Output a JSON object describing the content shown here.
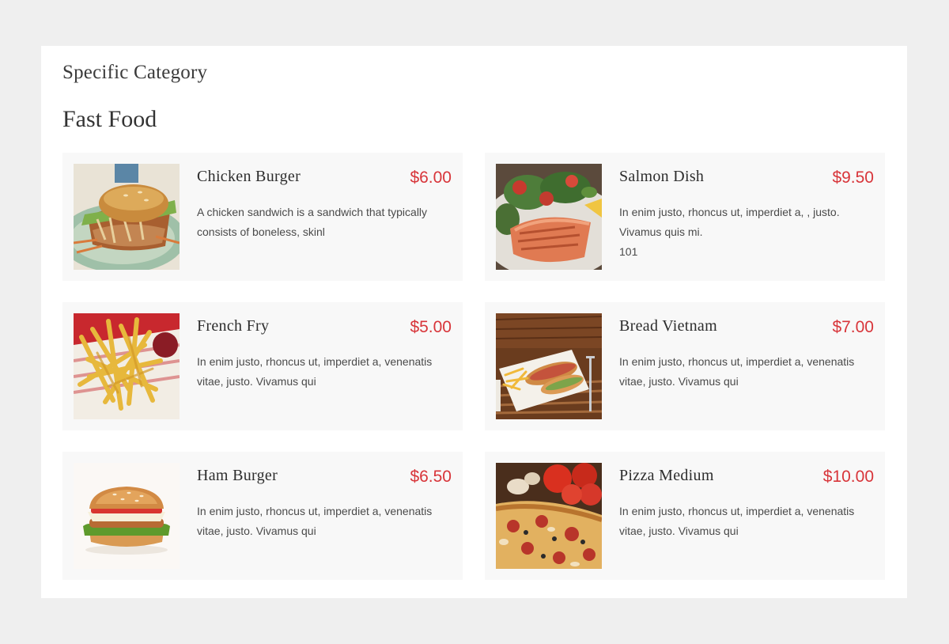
{
  "page": {
    "category_label": "Specific Category",
    "section_title": "Fast Food"
  },
  "theme": {
    "price_color": "#d8353a",
    "card_background": "#f8f8f8",
    "page_background": "#efefef"
  },
  "menu": {
    "items": [
      {
        "name": "Chicken Burger",
        "price": "$6.00",
        "description": "A chicken sandwich is a sandwich that typically consists of boneless, skinl",
        "image": "chicken-burger-photo"
      },
      {
        "name": "Salmon Dish",
        "price": "$9.50",
        "description": "In enim justo, rhoncus ut, imperdiet a, , justo. Vivamus quis mi.\n101",
        "image": "salmon-dish-photo"
      },
      {
        "name": "French Fry",
        "price": "$5.00",
        "description": "In enim justo, rhoncus ut, imperdiet a, venenatis vitae, justo. Vivamus qui",
        "image": "french-fry-photo"
      },
      {
        "name": "Bread Vietnam",
        "price": "$7.00",
        "description": "In enim justo, rhoncus ut, imperdiet a, venenatis vitae, justo. Vivamus qui",
        "image": "bread-vietnam-photo"
      },
      {
        "name": "Ham Burger",
        "price": "$6.50",
        "description": "In enim justo, rhoncus ut, imperdiet a, venenatis vitae, justo. Vivamus qui",
        "image": "ham-burger-photo"
      },
      {
        "name": "Pizza Medium",
        "price": "$10.00",
        "description": "In enim justo, rhoncus ut, imperdiet a, venenatis vitae, justo. Vivamus qui",
        "image": "pizza-medium-photo"
      }
    ]
  }
}
